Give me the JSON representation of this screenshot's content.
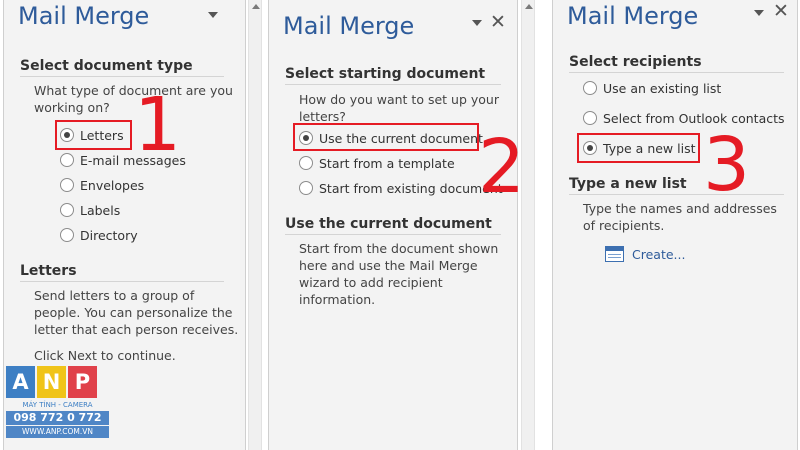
{
  "pane1": {
    "title": "Mail Merge",
    "section1_heading": "Select document type",
    "question": "What type of document are you working on?",
    "options": [
      {
        "label": "Letters",
        "checked": true
      },
      {
        "label": "E-mail messages",
        "checked": false
      },
      {
        "label": "Envelopes",
        "checked": false
      },
      {
        "label": "Labels",
        "checked": false
      },
      {
        "label": "Directory",
        "checked": false
      }
    ],
    "section2_heading": "Letters",
    "description": "Send letters to a group of people. You can personalize the letter that each person receives.",
    "next_hint": "Click Next to continue."
  },
  "pane2": {
    "title": "Mail Merge",
    "close_glyph": "✕",
    "section1_heading": "Select starting document",
    "question": "How do you want to set up your letters?",
    "options": [
      {
        "label": "Use the current document",
        "checked": true
      },
      {
        "label": "Start from a template",
        "checked": false
      },
      {
        "label": "Start from existing document",
        "checked": false
      }
    ],
    "section2_heading": "Use the current document",
    "description": "Start from the document shown here and use the Mail Merge wizard to add recipient information."
  },
  "pane3": {
    "title": "Mail Merge",
    "close_glyph": "✕",
    "section1_heading": "Select recipients",
    "options": [
      {
        "label": "Use an existing list",
        "checked": false
      },
      {
        "label": "Select from Outlook contacts",
        "checked": false
      },
      {
        "label": "Type a new list",
        "checked": true
      }
    ],
    "section2_heading": "Type a new list",
    "description": "Type the names and addresses of recipients.",
    "create_link": "Create..."
  },
  "steps": [
    "1",
    "2",
    "3"
  ],
  "logo": {
    "letters": [
      "A",
      "N",
      "P"
    ],
    "letter_colors": [
      "#3d7fc4",
      "#f0c419",
      "#e0414a"
    ],
    "line1": "MÁY TÍNH - CAMERA",
    "line2": "098 772 0 772",
    "line3": "WWW.ANP.COM.VN"
  },
  "colors": {
    "title": "#2e5b9a",
    "highlight": "#e51b24",
    "pane_bg": "#f3f3f3"
  }
}
